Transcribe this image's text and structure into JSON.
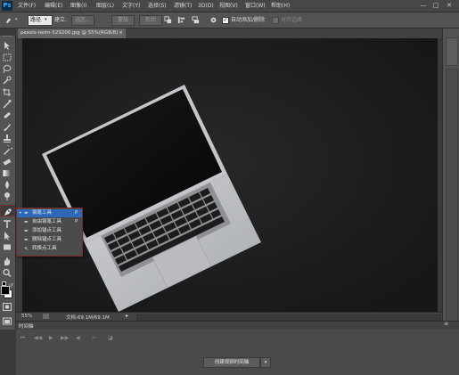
{
  "app": {
    "logo": "Ps"
  },
  "menu": [
    "文件(F)",
    "编辑(E)",
    "图像(I)",
    "图层(L)",
    "文字(Y)",
    "选择(S)",
    "滤镜(T)",
    "3D(D)",
    "视图(V)",
    "窗口(W)",
    "帮助(H)"
  ],
  "window_controls": {
    "minimize": "—",
    "maximize": "□",
    "close": "✕"
  },
  "options": {
    "mode_select": "路径",
    "make_label": "建立:",
    "selection_btn": "选区...",
    "mask_btn": "蒙版",
    "shape_btn": "形状",
    "auto_add_label": "自动添加/删除",
    "align_edges_label": "对齐边缘"
  },
  "document": {
    "tab_label": "pexels-neim-529200.jpg @ 55%(RGB/8)",
    "tab_close": "×"
  },
  "flyout": {
    "items": [
      {
        "label": "钢笔工具",
        "shortcut": "P"
      },
      {
        "label": "自由钢笔工具",
        "shortcut": "P"
      },
      {
        "label": "添加锚点工具",
        "shortcut": ""
      },
      {
        "label": "删除锚点工具",
        "shortcut": ""
      },
      {
        "label": "转换点工具",
        "shortcut": ""
      }
    ]
  },
  "status": {
    "zoom": "55%",
    "doc_info": "文档:69.1M/69.1M"
  },
  "timeline": {
    "title": "时间轴",
    "create_btn": "创建视频时间轴"
  },
  "colors": {
    "accent": "#2e68b8",
    "canvas": "#1d1d1d",
    "ps_blue": "#3fa9f5"
  }
}
